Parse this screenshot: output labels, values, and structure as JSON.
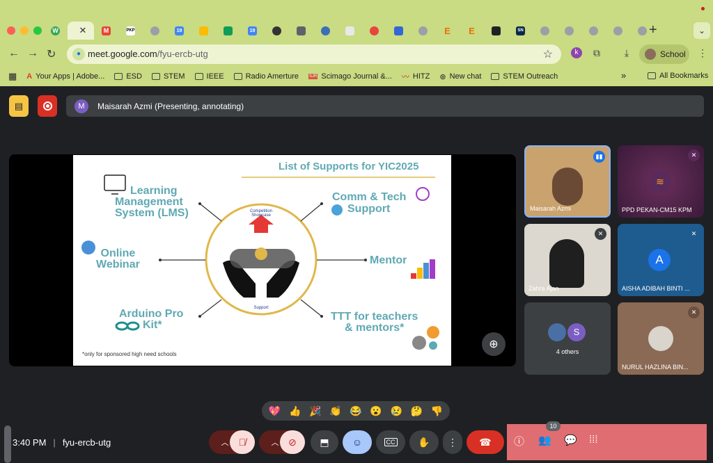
{
  "browser": {
    "url_host": "meet.google.com",
    "url_path": "/fyu-ercb-utg",
    "profile_label": "School",
    "extension_badge": "k",
    "bookmarks": [
      "Your Apps | Adobe...",
      "ESD",
      "STEM",
      "IEEE",
      "Radio Amerture",
      "Scimago Journal &...",
      "HITZ",
      "New chat",
      "STEM Outreach"
    ],
    "all_bookmarks": "All Bookmarks",
    "tab_icons": [
      "W",
      "M",
      "PKP",
      "",
      "19",
      "",
      "",
      "19",
      "",
      "",
      "",
      "",
      "",
      "",
      "E",
      "E",
      "",
      "SN",
      "",
      "",
      "",
      "",
      ""
    ]
  },
  "meet": {
    "presenter_initial": "M",
    "presenting_label": "Maisarah Azmi (Presenting, annotating)",
    "time": "3:40 PM",
    "meeting_code": "fyu-ercb-utg",
    "participants_count": "10",
    "reactions": [
      "💖",
      "👍",
      "🎉",
      "👏",
      "😂",
      "😮",
      "😢",
      "🤔",
      "👎"
    ]
  },
  "slide": {
    "title": "List of Supports for YIC2025",
    "center_top": "Competition Showcase",
    "center_bottom": "Support",
    "lms": [
      "Learning",
      "Management",
      "System (LMS)"
    ],
    "comm": [
      "Comm & Tech",
      "Support"
    ],
    "webinar": [
      "Online",
      "Webinar"
    ],
    "mentor": "Mentor",
    "arduino": [
      "Arduino Pro",
      "Kit*"
    ],
    "ttt": [
      "TTT for teachers",
      "& mentors*"
    ],
    "footnote": "*only for sponsored high need  schools"
  },
  "participants": [
    {
      "name": "Maisarah Azmi"
    },
    {
      "name": "PPD PEKAN-CM15 KPM"
    },
    {
      "name": "Zahra Ajan"
    },
    {
      "name": "AISHA ADIBAH BINTI ...",
      "initial": "A"
    },
    {
      "name": "4 others",
      "initial": "S"
    },
    {
      "name": "NURUL HAZLINA BIN..."
    }
  ],
  "colors": {
    "slide_teal": "#5fa9b3",
    "slide_gold": "#e0b84a",
    "chrome": "#c9db83",
    "end_call": "#d93025",
    "tile_bg": "#3c4043"
  }
}
